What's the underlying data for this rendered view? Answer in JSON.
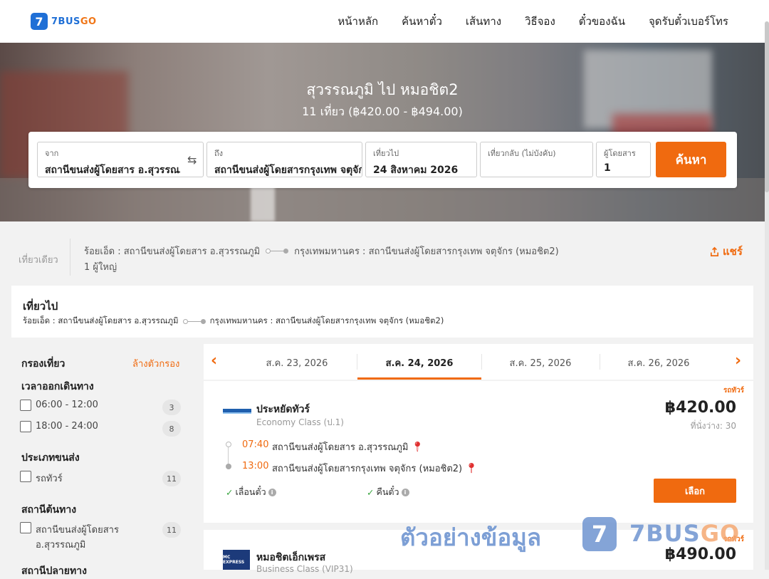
{
  "brand": {
    "logo_mark": "7",
    "logo_text_a": "7BUS",
    "logo_text_b": "GO"
  },
  "nav": {
    "items": [
      "หน้าหลัก",
      "ค้นหาตั๋ว",
      "เส้นทาง",
      "วิธีจอง",
      "ตั๋วของฉัน",
      "จุดรับตั๋วเบอร์โทร"
    ]
  },
  "hero": {
    "title": "สุวรรณภูมิ ไป หมอชิต2",
    "subtitle": "11 เที่ยว (฿420.00 - ฿494.00)"
  },
  "search": {
    "from_label": "จาก",
    "from_value": "สถานีขนส่งผู้โดยสาร อ.สุวรรณภูมิ",
    "swap_icon": "⇆",
    "to_label": "ถึง",
    "to_value": "สถานีขนส่งผู้โดยสารกรุงเทพ จตุจักร",
    "depart_label": "เที่ยวไป",
    "depart_value": "24 สิงหาคม 2026",
    "return_label": "เที่ยวกลับ (ไม่บังคับ)",
    "return_value": "",
    "pax_label": "ผู้โดยสาร",
    "pax_value": "1",
    "button": "ค้นหา"
  },
  "trip": {
    "type": "เที่ยวเดียว",
    "from": "ร้อยเอ็ด : สถานีขนส่งผู้โดยสาร อ.สุวรรณภูมิ",
    "to": "กรุงเทพมหานคร : สถานีขนส่งผู้โดยสารกรุงเทพ จตุจักร (หมอชิต2)",
    "pax": "1 ผู้ใหญ่",
    "share": "แชร์"
  },
  "outbound": {
    "title": "เที่ยวไป",
    "from": "ร้อยเอ็ด : สถานีขนส่งผู้โดยสาร อ.สุวรรณภูมิ",
    "to": "กรุงเทพมหานคร : สถานีขนส่งผู้โดยสารกรุงเทพ จตุจักร (หมอชิต2)"
  },
  "filters": {
    "title": "กรองเที่ยว",
    "clear": "ล้างตัวกรอง",
    "sections": [
      {
        "title": "เวลาออกเดินทาง",
        "options": [
          {
            "label": "06:00 - 12:00",
            "count": "3"
          },
          {
            "label": "18:00 - 24:00",
            "count": "8"
          }
        ]
      },
      {
        "title": "ประเภทขนส่ง",
        "options": [
          {
            "label": "รถทัวร์",
            "count": "11"
          }
        ]
      },
      {
        "title": "สถานีต้นทาง",
        "options": [
          {
            "label": "สถานีขนส่งผู้โดยสาร",
            "label2": "อ.สุวรรณภูมิ",
            "count": "11"
          }
        ]
      },
      {
        "title": "สถานีปลายทาง"
      }
    ]
  },
  "dates": {
    "items": [
      "ส.ค. 23, 2026",
      "ส.ค. 24, 2026",
      "ส.ค. 25, 2026",
      "ส.ค. 26, 2026"
    ],
    "active": "ส.ค. 24, 2026"
  },
  "results": [
    {
      "tag": "รถทัวร์",
      "operator": "ประหยัดทัวร์",
      "class": "Economy Class (ป.1)",
      "price": "฿420.00",
      "seats": "ที่นั่งว่าง: 30",
      "depart_time": "07:40",
      "depart_station": "สถานีขนส่งผู้โดยสาร อ.สุวรรณภูมิ",
      "arrive_time": "13:00",
      "arrive_station": "สถานีขนส่งผู้โดยสารกรุงเทพ จตุจักร (หมอชิต2)",
      "feature1": "เลื่อนตั๋ว",
      "feature2": "คืนตั๋ว",
      "button": "เลือก"
    },
    {
      "tag": "รถทัวร์",
      "operator": "หมอชิตเอ็กเพรส",
      "class": "Business Class (VIP31)",
      "price": "฿490.00",
      "logo_text": "MC EXPRESS"
    }
  ],
  "watermark": {
    "text": "ตัวอย่างข้อมูล",
    "logo_mark": "7",
    "logo_text_a": "7BUS",
    "logo_text_b": "GO"
  },
  "colors": {
    "accent": "#f06a0f",
    "brand": "#1f6fd6",
    "watermark": "#6f95d1"
  }
}
